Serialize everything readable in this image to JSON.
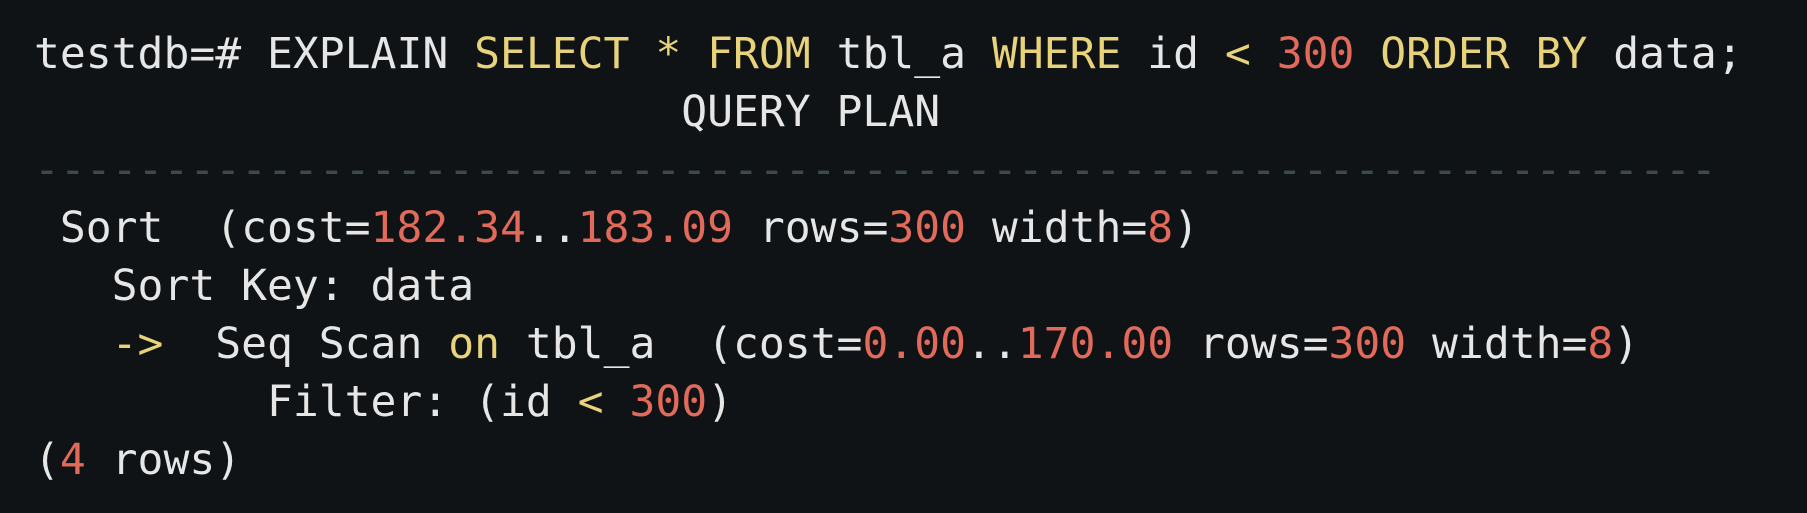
{
  "colors": {
    "background": "#0f1316",
    "text": "#e6e6e6",
    "keyword": "#e8d27a",
    "number": "#e26a5b",
    "separator": "#3e4a44"
  },
  "prompt": {
    "prefix": "testdb=# ",
    "explain": "EXPLAIN ",
    "select": "SELECT",
    "star": " * ",
    "from": "FROM",
    "table": " tbl_a ",
    "where": "WHERE",
    "column": " id ",
    "lt": "<",
    "space1": " ",
    "limit_value": "300",
    "space2": " ",
    "order_by": "ORDER BY",
    "order_column": " data;"
  },
  "header": {
    "indent": "                         ",
    "title": "QUERY PLAN"
  },
  "separator": "-----------------------------------------------------------------",
  "plan": {
    "sort_line": {
      "label": " Sort  (cost=",
      "cost_start": "182.34",
      "dots": "..",
      "cost_end": "183.09",
      "rows_label": " rows=",
      "rows": "300",
      "width_label": " width=",
      "width": "8",
      "close": ")"
    },
    "sort_key_line": {
      "text": "   Sort Key: data"
    },
    "scan_line": {
      "indent": "   ",
      "arrow": "->",
      "label": "  Seq Scan ",
      "on": "on",
      "table": " tbl_a  (cost=",
      "cost_start": "0.00",
      "dots": "..",
      "cost_end": "170.00",
      "rows_label": " rows=",
      "rows": "300",
      "width_label": " width=",
      "width": "8",
      "close": ")"
    },
    "filter_line": {
      "label": "         Filter: (id ",
      "lt": "<",
      "space": " ",
      "value": "300",
      "close": ")"
    }
  },
  "footer": {
    "open": "(",
    "count": "4",
    "label": " rows)"
  }
}
